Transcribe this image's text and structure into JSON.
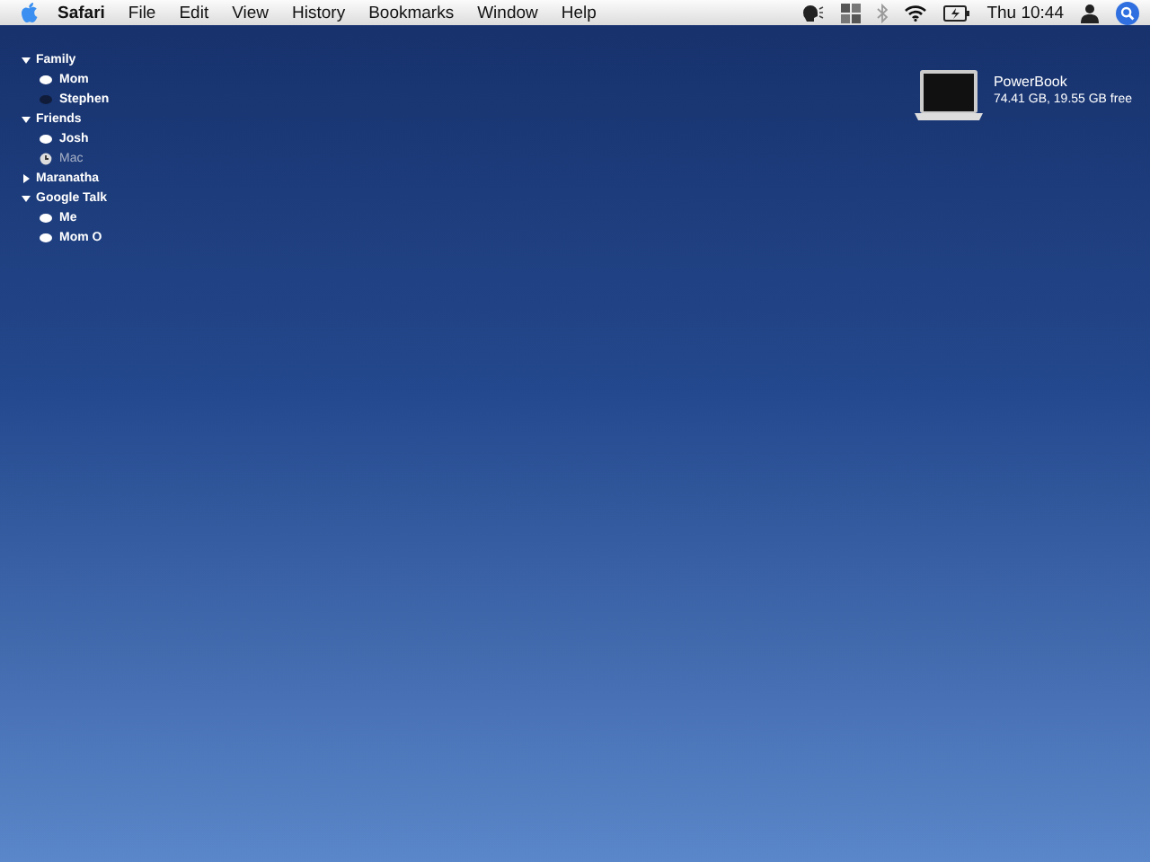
{
  "menu_bar": {
    "app_name": "Safari",
    "menus": [
      "File",
      "Edit",
      "View",
      "History",
      "Bookmarks",
      "Window",
      "Help"
    ],
    "clock": "Thu 10:44"
  },
  "buddy_list": [
    {
      "name": "Family",
      "expanded": true,
      "children": [
        {
          "name": "Mom",
          "kind": "available"
        },
        {
          "name": "Stephen",
          "kind": "offline"
        }
      ]
    },
    {
      "name": "Friends",
      "expanded": true,
      "children": [
        {
          "name": "Josh",
          "kind": "available"
        },
        {
          "name": "Mac",
          "kind": "idle"
        }
      ]
    },
    {
      "name": "Maranatha",
      "expanded": false
    },
    {
      "name": "Google Talk",
      "expanded": true,
      "children": [
        {
          "name": "Me",
          "kind": "available"
        },
        {
          "name": "Mom O",
          "kind": "available"
        }
      ]
    }
  ],
  "desktop_drive": {
    "name": "PowerBook",
    "info": "74.41 GB, 19.55 GB free"
  }
}
